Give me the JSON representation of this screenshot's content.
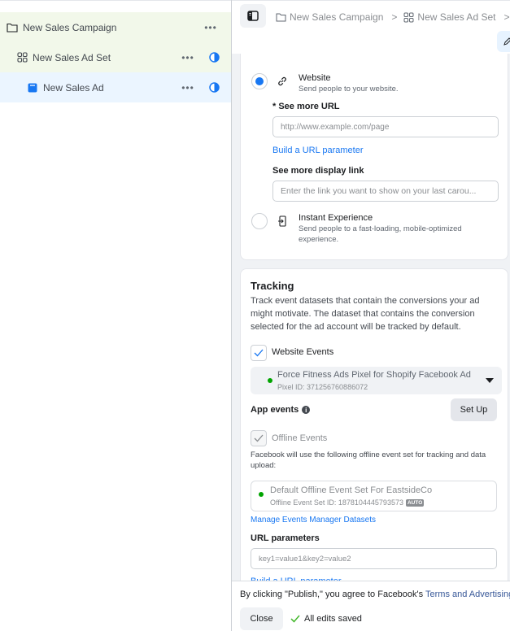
{
  "tree": {
    "items": [
      {
        "label": "New Sales Campaign",
        "icon": "folder-icon",
        "more": "•••"
      },
      {
        "label": "New Sales Ad Set",
        "icon": "grid-icon",
        "more": "•••",
        "status_icon": "half-circle-icon"
      },
      {
        "label": "New Sales Ad",
        "icon": "ad-icon",
        "more": "•••",
        "status_icon": "half-circle-icon"
      }
    ]
  },
  "breadcrumb": {
    "items": [
      {
        "label": "New Sales Campaign",
        "icon": "folder-icon"
      },
      {
        "label": "New Sales Ad Set",
        "icon": "grid-icon"
      }
    ],
    "separator": ">"
  },
  "destination": {
    "website": {
      "title": "Website",
      "subtitle": "Send people to your website.",
      "selected": true
    },
    "see_more_url": {
      "label": "* See more URL",
      "placeholder": "http://www.example.com/page",
      "value": ""
    },
    "build_url_link": "Build a URL parameter",
    "display_link": {
      "label": "See more display link",
      "placeholder": "Enter the link you want to show on your last carou..."
    },
    "instant_experience": {
      "title": "Instant Experience",
      "subtitle": "Send people to a fast-loading, mobile-optimized experience.",
      "selected": false
    }
  },
  "tracking": {
    "title": "Tracking",
    "description": "Track event datasets that contain the conversions your ad might motivate. The dataset that contains the conversion selected for the ad account will be tracked by default.",
    "website_events": {
      "label": "Website Events",
      "checked": true
    },
    "pixel": {
      "name": "Force Fitness Ads Pixel for Shopify Facebook Ad",
      "id_text": "Pixel ID: 371256760886072",
      "status_color": "#00a400"
    },
    "app_events": {
      "label": "App events",
      "setup_label": "Set Up"
    },
    "offline_events": {
      "label": "Offline Events",
      "checked": true,
      "disabled": true
    },
    "offline_description": "Facebook will use the following offline event set for tracking and data upload:",
    "offline_set": {
      "name": "Default Offline Event Set For EastsideCo",
      "id_text": "Offline Event Set ID: 1878104445793573",
      "badge": "AUTO",
      "status_color": "#00a400"
    },
    "manage_link": "Manage Events Manager Datasets",
    "url_params": {
      "label": "URL parameters",
      "placeholder": "key1=value1&key2=value2"
    },
    "build_url_link": "Build a URL parameter"
  },
  "footer": {
    "terms_prefix": "By clicking \"Publish,\" you agree to Facebook's ",
    "terms_link": "Terms and Advertising",
    "close_label": "Close",
    "saved_status": "All edits saved"
  },
  "colors": {
    "accent": "#1877f2",
    "success": "#42b72a",
    "campaign_bg": "#f2f8ea",
    "selected_bg": "#ebf5ff"
  }
}
